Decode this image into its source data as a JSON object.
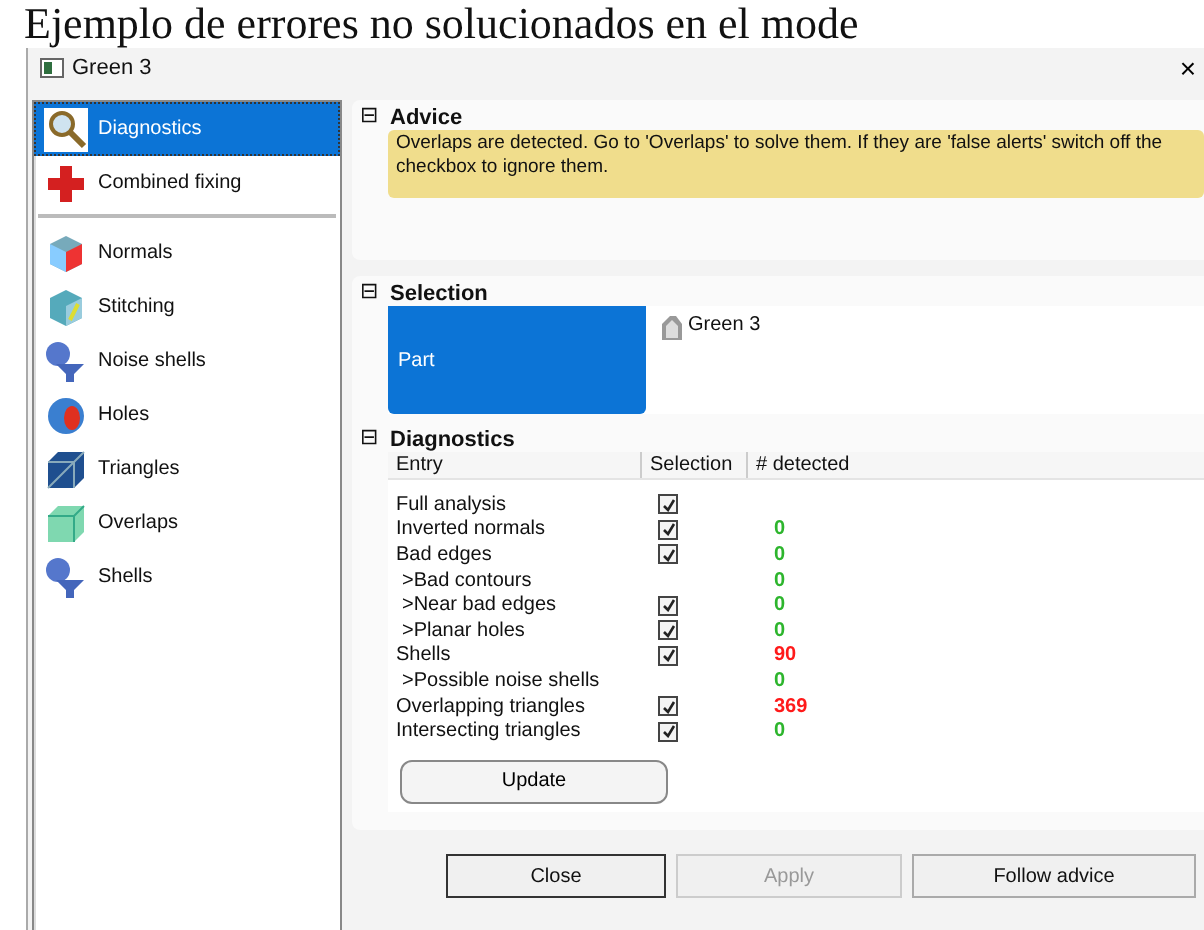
{
  "caption": "Ejemplo de errores no solucionados en el mode",
  "window": {
    "title": "Green 3",
    "close": "×"
  },
  "sidebar": {
    "items": [
      {
        "label": "Diagnostics",
        "selected": true
      },
      {
        "label": "Combined fixing",
        "selected": false
      },
      {
        "label": "Normals",
        "selected": false
      },
      {
        "label": "Stitching",
        "selected": false
      },
      {
        "label": "Noise shells",
        "selected": false
      },
      {
        "label": "Holes",
        "selected": false
      },
      {
        "label": "Triangles",
        "selected": false
      },
      {
        "label": "Overlaps",
        "selected": false
      },
      {
        "label": "Shells",
        "selected": false
      }
    ]
  },
  "advice": {
    "title": "Advice",
    "collapse": "⊟",
    "text": "Overlaps are detected. Go to 'Overlaps' to solve them. If they are 'false alerts' switch off the checkbox to ignore them."
  },
  "selection": {
    "title": "Selection",
    "collapse": "⊟",
    "label": "Part",
    "value": "Green 3"
  },
  "diagnostics": {
    "title": "Diagnostics",
    "collapse": "⊟",
    "columns": [
      "Entry",
      "Selection",
      "# detected"
    ],
    "rows": [
      {
        "entry": "Full analysis",
        "checked": true
      },
      {
        "entry": "Inverted normals",
        "checked": true,
        "detected": "0",
        "color": "#2db52d"
      },
      {
        "entry": "Bad edges",
        "checked": true,
        "detected": "0",
        "color": "#2db52d",
        "children": [
          {
            "entry": ">Bad contours",
            "detected": "0",
            "color": "#2db52d"
          },
          {
            "entry": ">Near bad edges",
            "checked": true,
            "detected": "0",
            "color": "#2db52d"
          },
          {
            "entry": ">Planar holes",
            "checked": true,
            "detected": "0",
            "color": "#2db52d"
          }
        ]
      },
      {
        "entry": "Shells",
        "checked": true,
        "detected": "90",
        "color": "#ff1a1a",
        "children": [
          {
            "entry": ">Possible noise shells",
            "detected": "0",
            "color": "#2db52d"
          }
        ]
      },
      {
        "entry": "Overlapping triangles",
        "checked": true,
        "detected": "369",
        "color": "#ff1a1a"
      },
      {
        "entry": "Intersecting triangles",
        "checked": true,
        "detected": "0",
        "color": "#2db52d"
      }
    ],
    "update": "Update"
  },
  "buttons": [
    {
      "label": "Close",
      "disabled": false,
      "focused": true
    },
    {
      "label": "Apply",
      "disabled": true,
      "focused": false
    },
    {
      "label": "Follow advice",
      "disabled": false,
      "focused": false
    }
  ]
}
